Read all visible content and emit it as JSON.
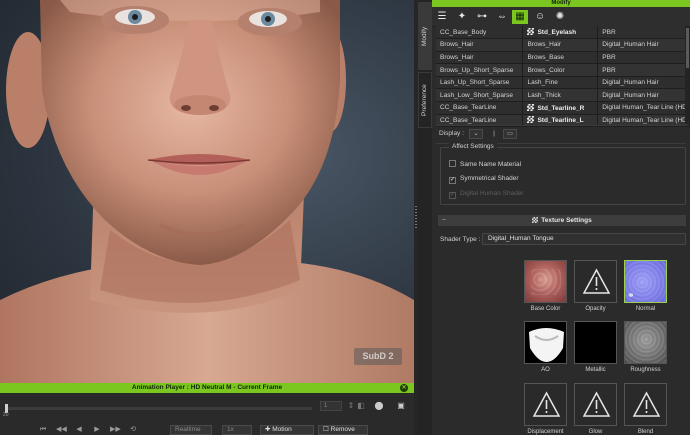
{
  "viewport": {
    "subd_label": "SubD 2"
  },
  "animation_player": {
    "title": "Animation Player : HD Neutral M - Current Frame",
    "frame_value": "1",
    "timeline_start": "20",
    "realtime_label": "Realtime",
    "fps_label": "1x",
    "motion_label": "Motion",
    "remove_label": "Remove"
  },
  "side_tabs": {
    "modify": "Modify",
    "preference": "Preference"
  },
  "panel": {
    "title": "Modify",
    "tool_icons": [
      "sliders-icon",
      "motion-icon",
      "morph-icon",
      "transform-icon",
      "material-icon",
      "head-icon",
      "physics-icon"
    ],
    "materials": [
      [
        "CC_Base_Body",
        "Std_Eyelash",
        "PBR"
      ],
      [
        "Brows_Hair",
        "Brows_Hair",
        "Digital_Human Hair"
      ],
      [
        "Brows_Hair",
        "Brows_Base",
        "PBR"
      ],
      [
        "Brows_Up_Short_Sparse",
        "Brows_Color",
        "PBR"
      ],
      [
        "Lash_Up_Short_Sparse",
        "Lash_Fine",
        "Digital_Human Hair"
      ],
      [
        "Lash_Low_Short_Sparse",
        "Lash_Thick",
        "Digital_Human Hair"
      ],
      [
        "CC_Base_TearLine",
        "Std_Tearline_R",
        "Digital Human_Tear Line (HD)"
      ],
      [
        "CC_Base_TearLine",
        "Std_Tearline_L",
        "Digital Human_Tear Line (HD)"
      ]
    ],
    "display_label": "Display :",
    "affect": {
      "title": "Affect Settings",
      "same_name": "Same Name Material",
      "symmetrical": "Symmetrical Shader",
      "digital_human": "Digital Human Shader"
    },
    "texture_settings": "Texture Settings",
    "shader_type_label": "Shader Type :",
    "shader_type_value": "Digital_Human Tongue",
    "textures": [
      {
        "label": "Base Color",
        "kind": "basecolor"
      },
      {
        "label": "Opacity",
        "kind": "warning"
      },
      {
        "label": "Normal",
        "kind": "normal"
      },
      {
        "label": "AO",
        "kind": "ao"
      },
      {
        "label": "Metallic",
        "kind": "metallic"
      },
      {
        "label": "Roughness",
        "kind": "roughness"
      },
      {
        "label": "Displacement",
        "kind": "warning"
      },
      {
        "label": "Glow",
        "kind": "warning"
      },
      {
        "label": "Blend",
        "kind": "warning"
      }
    ]
  }
}
